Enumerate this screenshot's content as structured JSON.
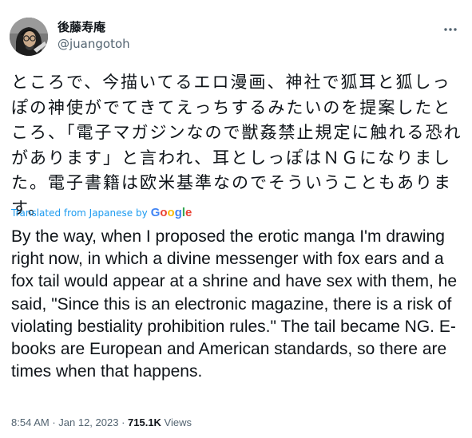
{
  "user": {
    "display_name": "後藤寿庵",
    "handle": "@juangotoh",
    "avatar_icon": "avatar-photo"
  },
  "more_icon": "more-dots-icon",
  "tweet": {
    "text_ja": "ところで、今描いてるエロ漫画、神社で狐耳と狐しっぽの神使がでてきてえっちするみたいのを提案したところ、「電子マガジンなので獣姦禁止規定に触れる恐れがあります」と言われ、耳としっぽはＮＧになりました。電子書籍は欧米基準なのでそういうこともあります。",
    "translated_label": "Translated from Japanese by",
    "google_label": "Google",
    "text_en": "By the way, when I proposed the erotic manga I'm drawing right now, in which a divine messenger with fox ears and a fox tail would appear at a shrine and have sex with them, he said, \"Since this is an electronic magazine, there is a risk of violating bestiality prohibition rules.\" The tail became NG. E-books are European and American standards, so there are times when that happens."
  },
  "meta": {
    "time": "8:54 AM",
    "separator1": " · ",
    "date": "Jan 12, 2023",
    "separator2": " · ",
    "views_count": "715.1K",
    "views_label": " Views"
  },
  "colors": {
    "text": "#0f1419",
    "secondary": "#536471",
    "link": "#1d9bf0",
    "google_blue": "#4285f4",
    "google_red": "#ea4335",
    "google_yellow": "#fbbc05",
    "google_green": "#34a853"
  }
}
